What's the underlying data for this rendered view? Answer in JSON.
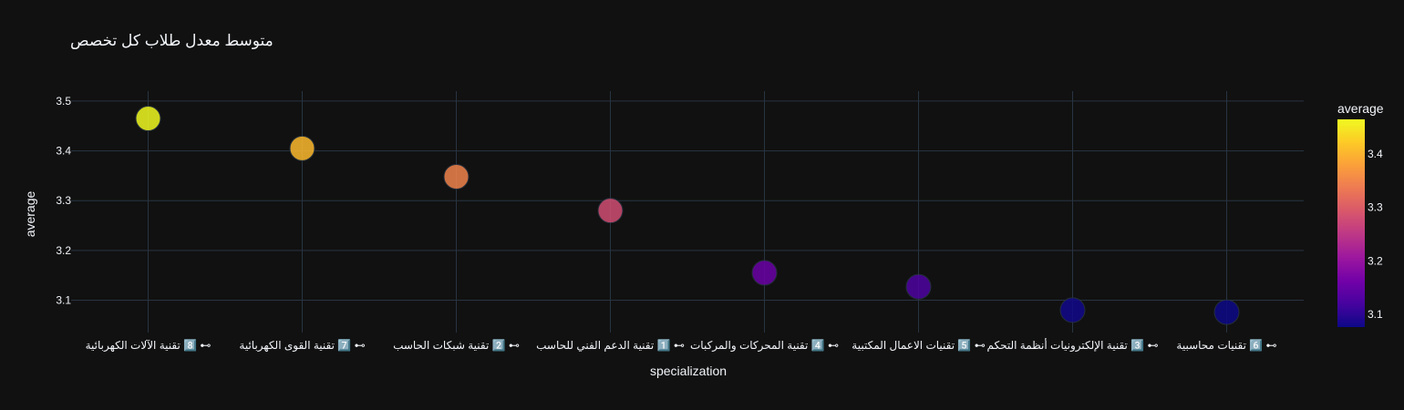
{
  "chart_data": {
    "type": "scatter",
    "title": "متوسط معدل طلاب كل تخصص",
    "xlabel": "specialization",
    "ylabel": "average",
    "categories": [
      "⊶ 8️⃣ تقنية الآلات الكهربائية",
      "⊶ 7️⃣ تقنية القوى الكهربائية",
      "⊶ 2️⃣ تقنية شبكات الحاسب",
      "⊶ 1️⃣ تقنية الدعم الفني للحاسب",
      "⊶ 4️⃣ تقنية المحركات والمركبات",
      "⊶ 5️⃣ تقنيات الاعمال المكتبية",
      "⊶ 3️⃣ تقنية الإلكترونيات أنظمة التحكم",
      "⊶ 6️⃣ تقنيات محاسبية"
    ],
    "values": [
      3.465,
      3.405,
      3.348,
      3.28,
      3.155,
      3.127,
      3.08,
      3.076
    ],
    "ylim": [
      3.035,
      3.52
    ],
    "yticks": [
      3.1,
      3.2,
      3.3,
      3.4,
      3.5
    ],
    "grid": true,
    "colorbar": {
      "title": "average",
      "range": [
        3.076,
        3.465
      ],
      "ticks": [
        3.1,
        3.2,
        3.3,
        3.4
      ],
      "colorscale": [
        "#0d0887",
        "#46039f",
        "#7201a8",
        "#9c179e",
        "#bd3786",
        "#d8576b",
        "#ed7953",
        "#fb9f3a",
        "#fdca26",
        "#f0f921"
      ]
    },
    "marker_opacity": 0.85
  }
}
